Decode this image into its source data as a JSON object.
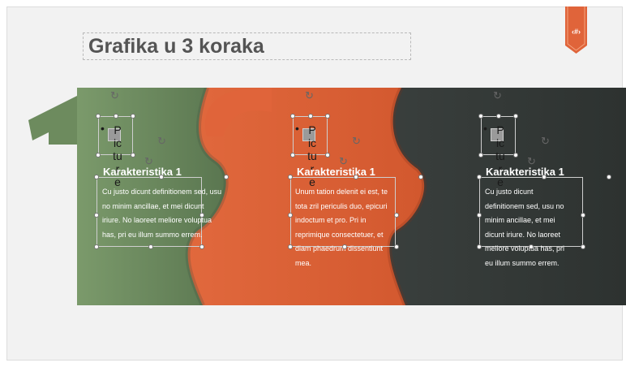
{
  "slide": {
    "title": "Grafika u 3 koraka",
    "slide_number_badge": "‹#›"
  },
  "cards": [
    {
      "heading": "Karakteristika 1",
      "body": "Cu justo dicunt definitionem sed, usu no minim ancillae, et mei dicunt iriure. No laoreet meliore voluptua has, pri eu illum summo errem.",
      "placeholder_text": "Picture",
      "bullet": "•"
    },
    {
      "heading": "Karakteristika 1",
      "body": "Unum tation delenit ei est, te tota zril periculis duo, epicuri indoctum et pro. Pri in reprimique consectetuer, et diam phaedrum dissentiunt mea.",
      "placeholder_text": "Picture",
      "bullet": "•"
    },
    {
      "heading": "Karakteristika 1",
      "body": "Cu justo dicunt definitionem sed, usu no minim ancillae, et mei dicunt iriure. No laoreet meliore voluptua has, pri eu illum summo errem.",
      "placeholder_text": "Picture",
      "bullet": "•"
    }
  ],
  "colors": {
    "green": "#6b8a5c",
    "orange": "#e0643a",
    "dark": "#3a3f3d",
    "title_text": "#545454"
  },
  "icons": {
    "rotate": "rotate-handle-icon",
    "picture_placeholder": "picture-placeholder-icon",
    "ribbon": "bookmark-ribbon-icon"
  }
}
